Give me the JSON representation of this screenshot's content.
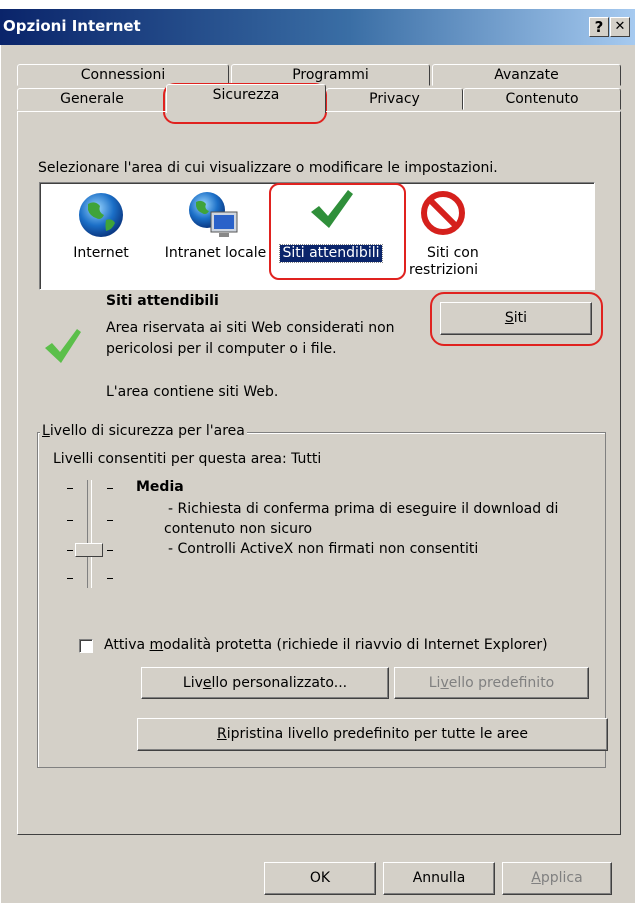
{
  "window": {
    "title": "Opzioni Internet",
    "help_button": "?",
    "close_button": "✕"
  },
  "tabs": {
    "row1": [
      "Connessioni",
      "Programmi",
      "Avanzate"
    ],
    "row2": [
      "Generale",
      "Sicurezza",
      "Privacy",
      "Contenuto"
    ]
  },
  "security": {
    "instruction": "Selezionare l'area di cui visualizzare o modificare le impostazioni.",
    "zones": [
      {
        "label": "Internet",
        "icon": "globe-icon"
      },
      {
        "label": "Intranet locale",
        "icon": "intranet-icon"
      },
      {
        "label": "Siti attendibili",
        "icon": "checkmark-icon"
      },
      {
        "label1": "Siti con",
        "label2": "restrizioni",
        "icon": "restricted-icon"
      }
    ],
    "selected_zone": {
      "title": "Siti attendibili",
      "desc1": "Area riservata ai siti Web considerati non",
      "desc2": "pericolosi per il computer o i file.",
      "contains": "L'area contiene siti Web."
    },
    "sites_button_prefix": "S",
    "sites_button_rest": "iti"
  },
  "level_group": {
    "legend_prefix": "L",
    "legend_rest": "ivello di sicurezza per l'area",
    "allowed": "Livelli consentiti per questa area: Tutti",
    "level_name": "Media",
    "bullet1a": "- Richiesta di conferma prima di eseguire il download di",
    "bullet1b": "contenuto non sicuro",
    "bullet2": "- Controlli ActiveX non firmati non consentiti",
    "protected_mode_pre": "Attiva ",
    "protected_mode_key": "m",
    "protected_mode_rest": "odalità protetta (richiede il riavvio di Internet Explorer)",
    "custom_pre": "Liv",
    "custom_key": "e",
    "custom_rest": "llo personalizzato...",
    "default_pre": "Li",
    "default_key": "v",
    "default_rest": "ello predefinito"
  },
  "reset_pre": "",
  "reset_key": "R",
  "reset_rest": "ipristina livello predefinito per tutte le aree",
  "footer": {
    "ok": "OK",
    "cancel": "Annulla",
    "apply_key": "A",
    "apply_rest": "pplica"
  },
  "colors": {
    "highlight": "#e0221f",
    "selection": "#0a246a"
  }
}
